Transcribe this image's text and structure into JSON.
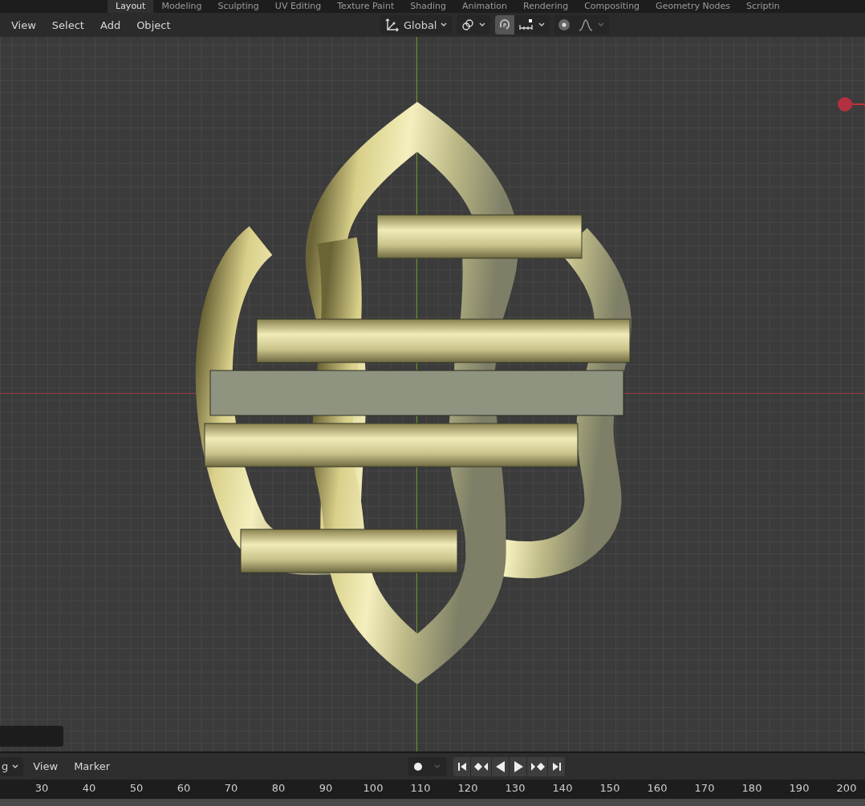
{
  "workspace_tabs": [
    {
      "label": "Layout",
      "selected": true
    },
    {
      "label": "Modeling",
      "selected": false
    },
    {
      "label": "Sculpting",
      "selected": false
    },
    {
      "label": "UV Editing",
      "selected": false
    },
    {
      "label": "Texture Paint",
      "selected": false
    },
    {
      "label": "Shading",
      "selected": false
    },
    {
      "label": "Animation",
      "selected": false
    },
    {
      "label": "Rendering",
      "selected": false
    },
    {
      "label": "Compositing",
      "selected": false
    },
    {
      "label": "Geometry Nodes",
      "selected": false
    },
    {
      "label": "Scriptin",
      "selected": false
    }
  ],
  "viewport_header": {
    "menus": [
      "View",
      "Select",
      "Add",
      "Object"
    ],
    "transform_orientation": "Global",
    "snapping_on": true,
    "proportional_editing_on": false
  },
  "timeline": {
    "editor_dropdown": "g",
    "menus": [
      "View",
      "Marker"
    ],
    "auto_keying_on": false,
    "frame_labels": [
      "30",
      "40",
      "50",
      "60",
      "70",
      "80",
      "90",
      "100",
      "110",
      "120",
      "130",
      "140",
      "150",
      "160",
      "170",
      "180",
      "190",
      "200"
    ]
  }
}
